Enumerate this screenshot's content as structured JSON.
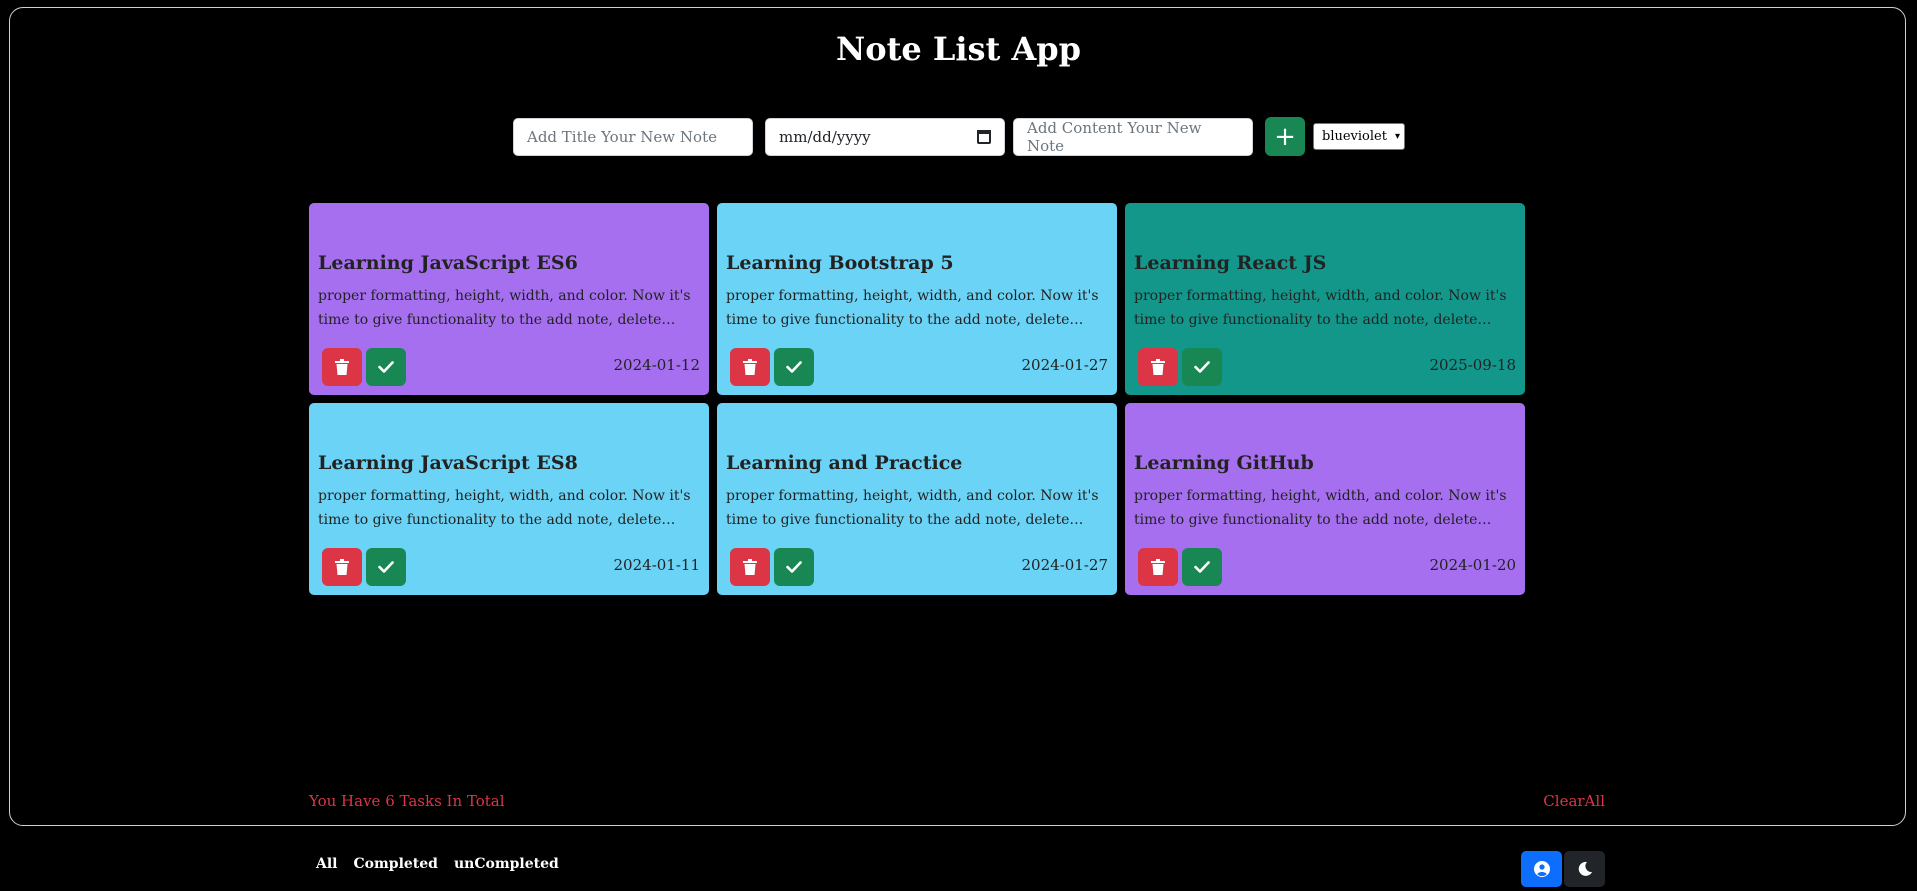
{
  "app": {
    "title": "Note List App"
  },
  "form": {
    "title_placeholder": "Add Title Your New Note",
    "date_placeholder": "mm/dd/yyyy",
    "content_placeholder": "Add Content Your New Note",
    "add_icon": "plus-icon",
    "add_label": "+",
    "color_selected": "blueviolet"
  },
  "notes": [
    {
      "title": "Learning JavaScript ES6",
      "content": "proper formatting, height, width, and color. Now it's time to give functionality to the add note, delete button and complete button.",
      "date": "2024-01-12",
      "color": "#a66ff0"
    },
    {
      "title": "Learning Bootstrap 5",
      "content": "proper formatting, height, width, and color. Now it's time to give functionality to the add note, delete button and complete button.",
      "date": "2024-01-27",
      "color": "#6bd4f6"
    },
    {
      "title": "Learning React JS",
      "content": "proper formatting, height, width, and color. Now it's time to give functionality to the add note, delete button and complete button.",
      "date": "2025-09-18",
      "color": "#13978b"
    },
    {
      "title": "Learning JavaScript ES8",
      "content": "proper formatting, height, width, and color. Now it's time to give functionality to the add note, delete button and complete button.",
      "date": "2024-01-11",
      "color": "#6bd4f6"
    },
    {
      "title": "Learning and Practice",
      "content": "proper formatting, height, width, and color. Now it's time to give functionality to the add note, delete button and complete button.",
      "date": "2024-01-27",
      "color": "#6bd4f6"
    },
    {
      "title": "Learning GitHub",
      "content": "proper formatting, height, width, and color. Now it's time to give functionality to the add note, delete button and complete button.",
      "date": "2024-01-20",
      "color": "#a66ff0"
    }
  ],
  "footer": {
    "summary": "You Have 6 Tasks In Total",
    "clear_all": "ClearAll",
    "filters": [
      "All",
      "Completed",
      "unCompleted"
    ]
  },
  "colors": {
    "danger": "#dc3545",
    "success": "#198754",
    "primary": "#0d6efd",
    "dark": "#212529"
  },
  "icons": {
    "delete": "trash-icon",
    "complete": "check-icon",
    "profile": "user-circle-icon",
    "theme": "moon-icon"
  }
}
